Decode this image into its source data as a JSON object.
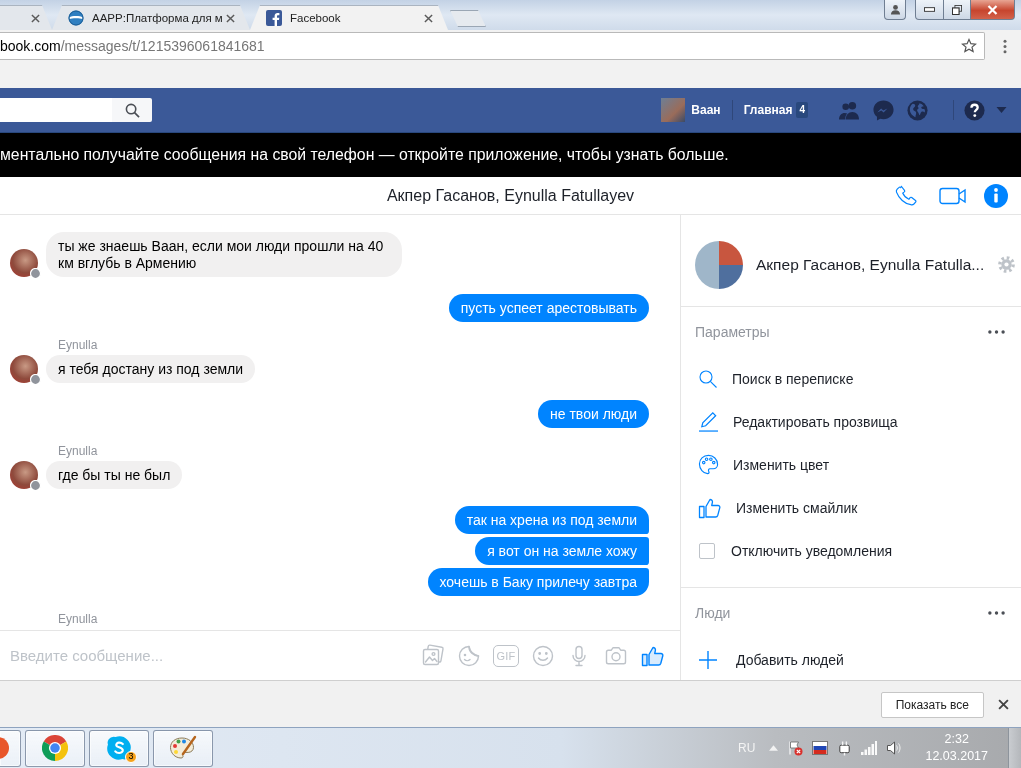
{
  "browser": {
    "tabs": [
      {
        "kind": "partial",
        "selected": false
      },
      {
        "kind": "portal",
        "title": "AAPP:Платформа для м",
        "selected": false
      },
      {
        "kind": "facebook",
        "title": "Facebook",
        "selected": true
      }
    ],
    "address": {
      "host": "book.com",
      "path": "/messages/t/1215396061841681"
    }
  },
  "top_bar": {
    "user_name": "Ваан",
    "home_label": "Главная",
    "home_count": "4"
  },
  "banner": {
    "text": "ментально получайте сообщения на свой телефон — откройте приложение, чтобы узнать больше."
  },
  "conversation": {
    "title": "Акпер Гасанов, Eynulla Fatullayev",
    "groups": [
      {
        "kind": "received",
        "messages": [
          "ты же знаешь Ваан, если мои люди прошли на 40 км вглубь в Армению"
        ]
      },
      {
        "kind": "sent",
        "messages": [
          "пусть успеет арестовывать"
        ]
      },
      {
        "kind": "received",
        "sender": "Eynulla",
        "messages": [
          "я тебя достану из под земли"
        ]
      },
      {
        "kind": "sent",
        "messages": [
          "не твои люди"
        ]
      },
      {
        "kind": "received",
        "sender": "Eynulla",
        "messages": [
          "где бы ты не был"
        ]
      },
      {
        "kind": "sent",
        "messages": [
          "так на хрена из под земли",
          "я вот он на земле хожу",
          "хочешь в Баку прилечу завтра"
        ]
      },
      {
        "kind": "received",
        "sender": "Eynulla"
      }
    ],
    "composer": {
      "placeholder": "Введите сообщение...",
      "gif_label": "GIF"
    }
  },
  "info_panel": {
    "name": "Акпер Гасанов, Eynulla Fatulla...",
    "sections": [
      {
        "title": "Параметры",
        "items": [
          {
            "kind": "search",
            "label": "Поиск в переписке"
          },
          {
            "kind": "edit",
            "label": "Редактировать прозвища"
          },
          {
            "kind": "color",
            "label": "Изменить цвет"
          },
          {
            "kind": "emoji",
            "label": "Изменить смайлик"
          },
          {
            "kind": "toggle",
            "label": "Отключить уведомления",
            "checked": false
          }
        ]
      },
      {
        "title": "Люди",
        "items": [
          {
            "kind": "add",
            "label": "Добавить людей"
          }
        ]
      }
    ]
  },
  "download_bar": {
    "button": "Показать все"
  },
  "taskbar": {
    "apps": [
      {
        "kind": "partial"
      },
      {
        "kind": "browser"
      },
      {
        "kind": "chat",
        "badge": "3"
      },
      {
        "kind": "paint"
      }
    ],
    "language": "RU",
    "time": "2:32",
    "date": "12.03.2017"
  }
}
